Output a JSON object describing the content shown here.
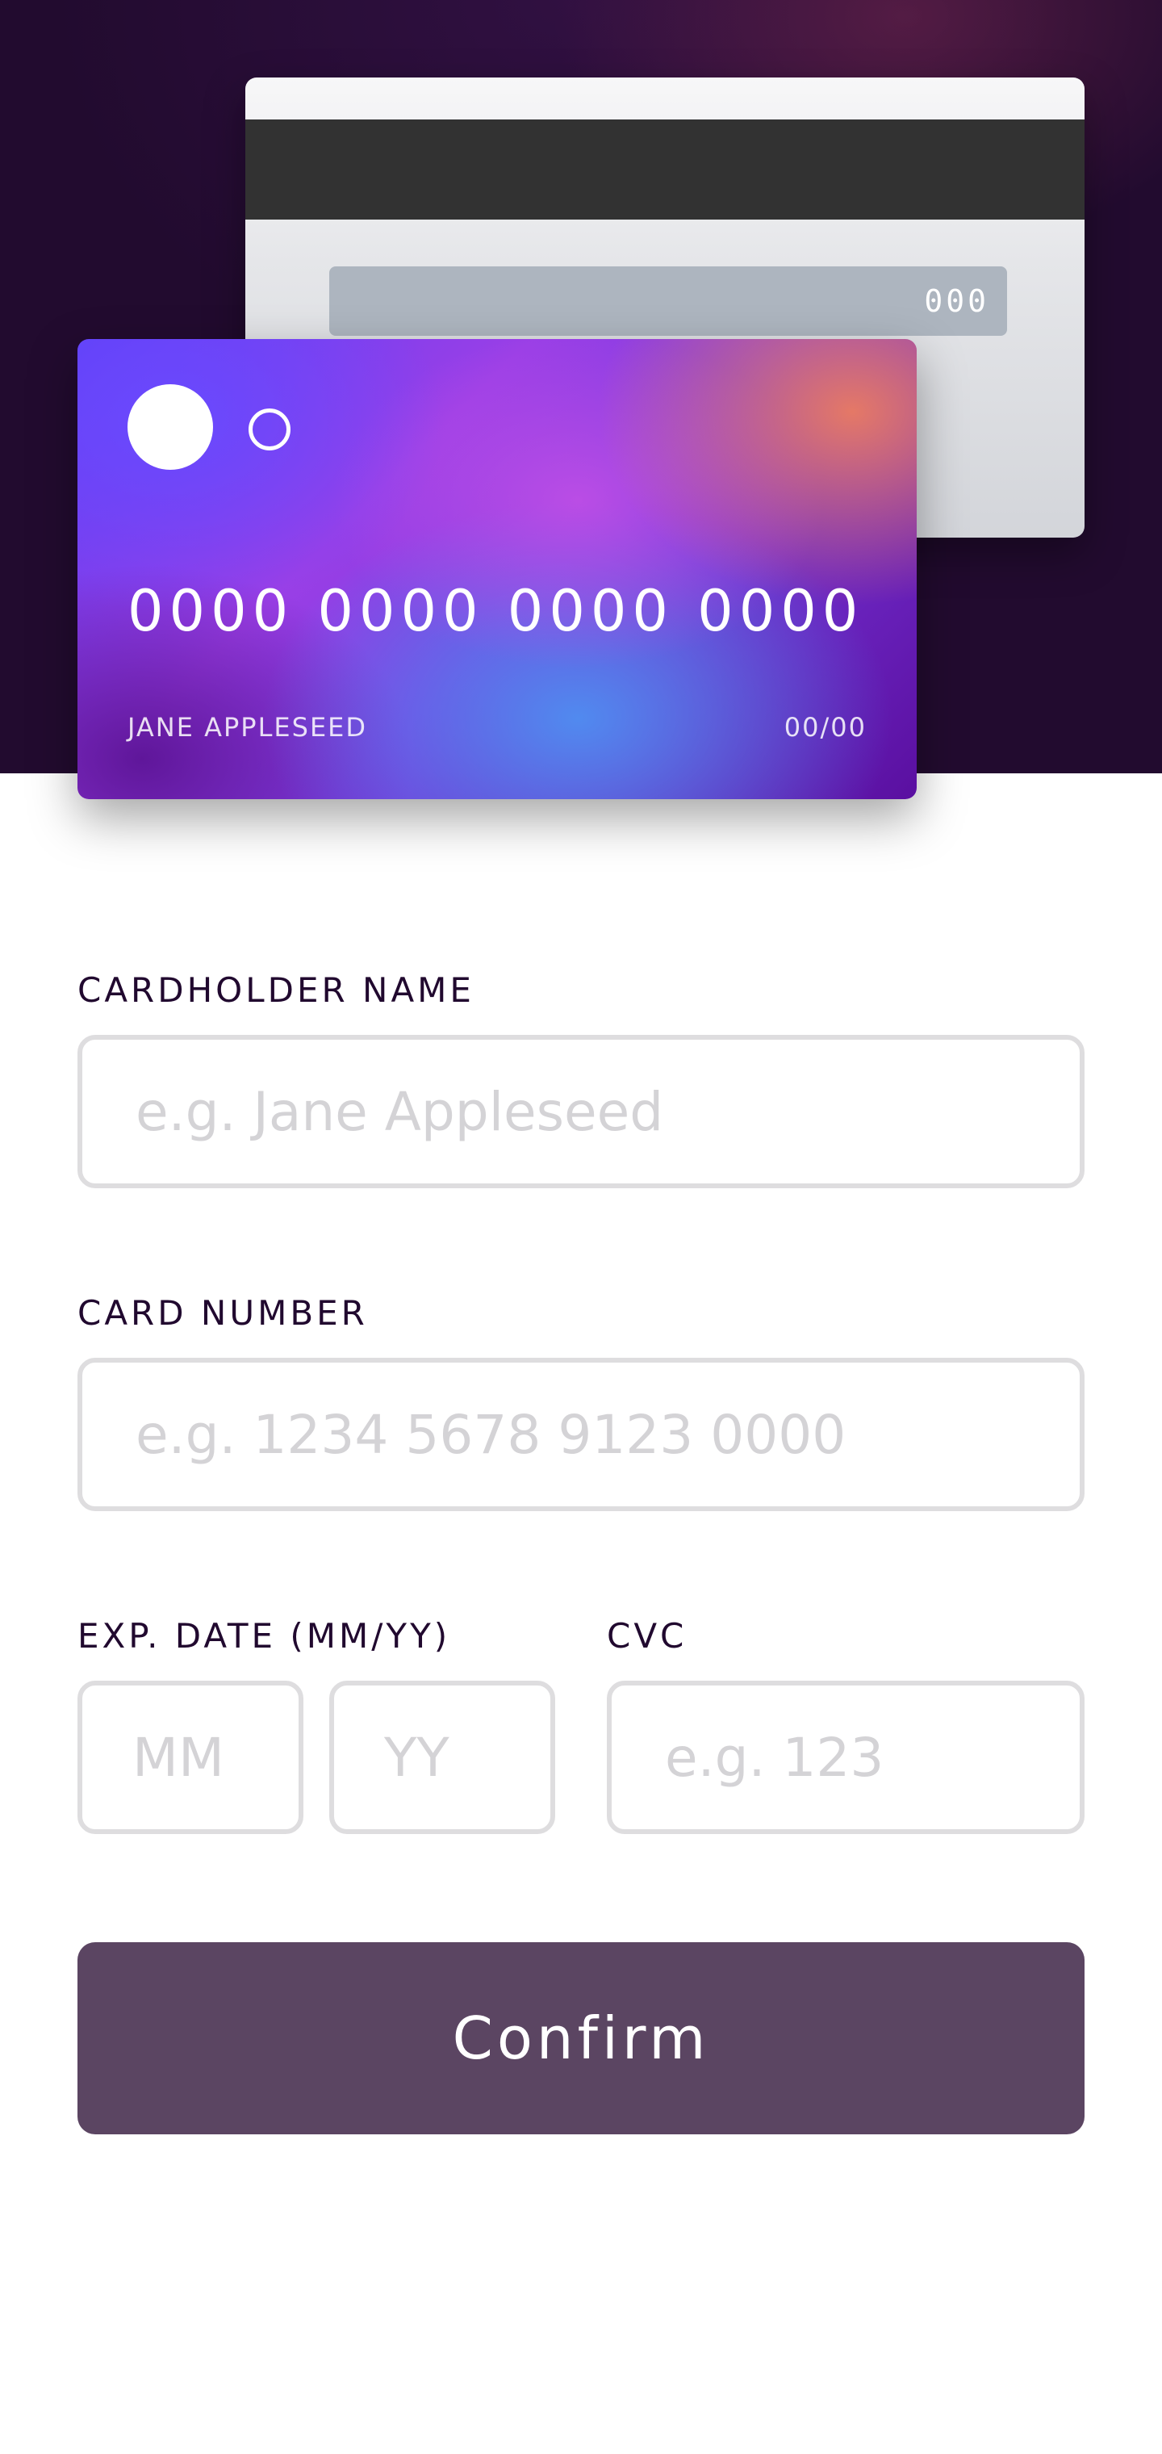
{
  "card_back": {
    "cvc": "000"
  },
  "card_front": {
    "number": "0000 0000 0000 0000",
    "holder": "JANE APPLESEED",
    "expiry": "00/00"
  },
  "form": {
    "name": {
      "label": "CARDHOLDER NAME",
      "placeholder": "e.g. Jane Appleseed",
      "value": ""
    },
    "number": {
      "label": "CARD NUMBER",
      "placeholder": "e.g. 1234 5678 9123 0000",
      "value": ""
    },
    "expiry": {
      "label": "EXP. DATE (MM/YY)",
      "month_placeholder": "MM",
      "year_placeholder": "YY"
    },
    "cvc": {
      "label": "CVC",
      "placeholder": "e.g. 123",
      "value": ""
    },
    "confirm_label": "Confirm"
  },
  "colors": {
    "hero_bg": "#220b2f",
    "button_bg": "#5b4562",
    "input_border": "#dedddf",
    "label_text": "#21092f"
  }
}
